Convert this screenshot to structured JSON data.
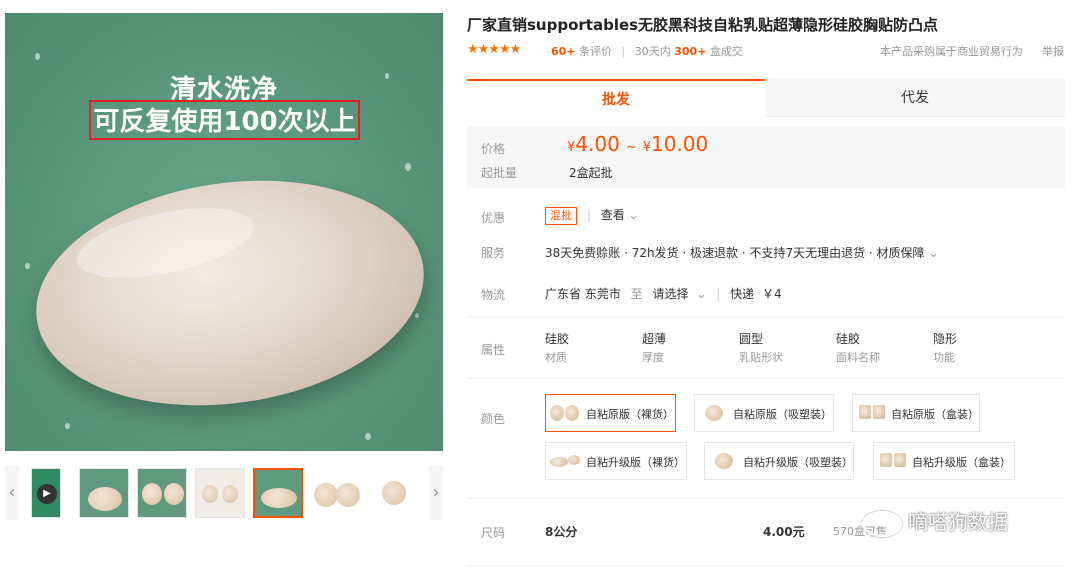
{
  "product": {
    "title": "厂家直销supportables无胶黑科技自粘乳贴超薄隐形硅胶胸贴防凸点",
    "stars": "★★★★★",
    "reviews_count": "60+",
    "reviews_label": "条评价",
    "sales_label_prefix": "30天内",
    "sales_count": "300+",
    "sales_label_suffix": "盒成交",
    "trade_note": "本产品采购属于商业贸易行为",
    "report": "举报"
  },
  "main_image": {
    "caption_line1": "清水洗净",
    "caption_line2": "可反复使用100次以上"
  },
  "thumbnails": {
    "prev": "‹",
    "next": "›",
    "play": "▶"
  },
  "tabs": [
    {
      "label": "批发",
      "active": true
    },
    {
      "label": "代发",
      "active": false
    }
  ],
  "pricing": {
    "price_label": "价格",
    "currency": "¥",
    "price_low": "4.00",
    "tilde": "~",
    "price_high": "10.00",
    "moq_label": "起批量",
    "moq_value": "2盒起批"
  },
  "promo": {
    "label": "优惠",
    "tag": "混批",
    "view": "查看",
    "chevron": "⌄"
  },
  "service": {
    "label": "服务",
    "value": "38天免费赊账 · 72h发货 · 极速退款 · 不支持7天无理由退货 · 材质保障",
    "chevron": "⌄"
  },
  "logistics": {
    "label": "物流",
    "from": "广东省 东莞市",
    "to_word": "至",
    "select": "请选择",
    "chevron": "⌄",
    "express": "快递",
    "fee": "￥4"
  },
  "attributes": {
    "label": "属性",
    "items": [
      {
        "value": "硅胶",
        "key": "材质"
      },
      {
        "value": "超薄",
        "key": "厚度"
      },
      {
        "value": "圆型",
        "key": "乳贴形状"
      },
      {
        "value": "硅胶",
        "key": "面料名称"
      },
      {
        "value": "隐形",
        "key": "功能"
      }
    ]
  },
  "colors": {
    "label": "颜色",
    "options": [
      {
        "label": "自粘原版（裸货）",
        "selected": true
      },
      {
        "label": "自粘原版（吸塑装）",
        "selected": false
      },
      {
        "label": "自粘原版（盒装）",
        "selected": false
      },
      {
        "label": "自粘升级版（裸货）",
        "selected": false
      },
      {
        "label": "自粘升级版（吸塑装）",
        "selected": false
      },
      {
        "label": "自粘升级版（盒装）",
        "selected": false
      }
    ]
  },
  "size": {
    "label": "尺码",
    "value": "8公分",
    "price": "4.00元",
    "stock": "570盒可售"
  },
  "watermark": "嘀嗒狗数据",
  "colors_hex": {
    "accent": "#ff5000",
    "image_bg": "#5f9a80",
    "caption_border": "#e1211f"
  }
}
